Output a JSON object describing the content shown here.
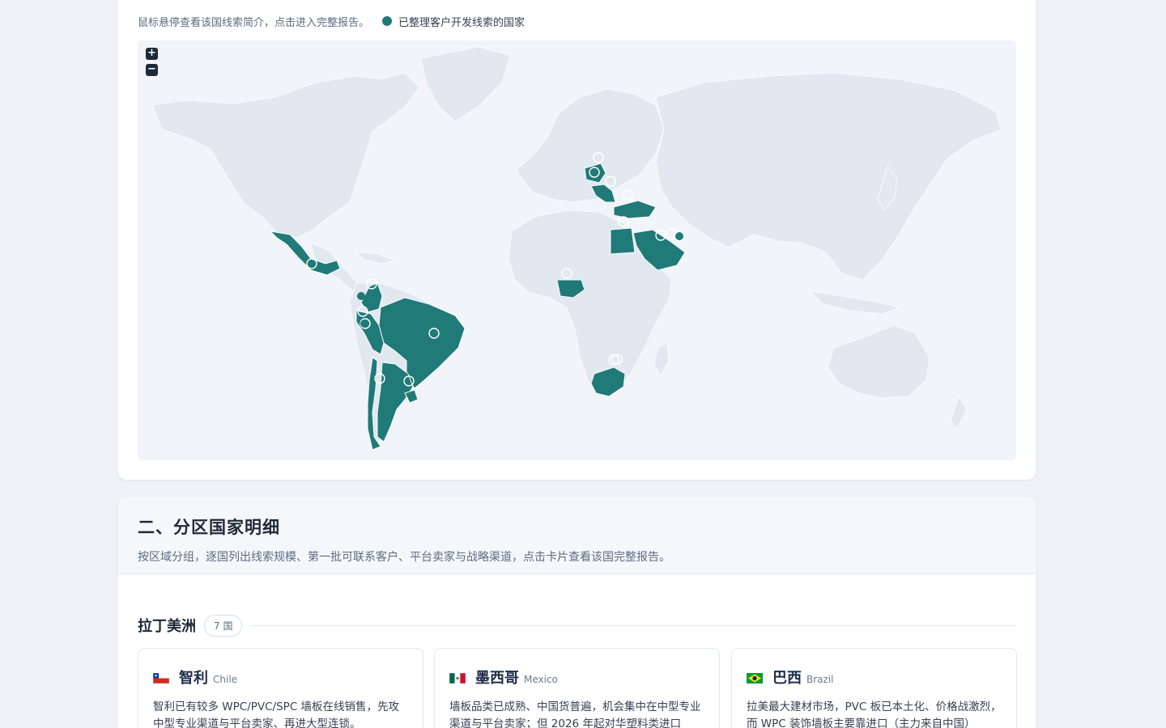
{
  "map_section": {
    "hint": "鼠标悬停查看该国线索简介，点击进入完整报告。",
    "legend_label": "已整理客户开发线索的国家",
    "zoom_in": "+",
    "zoom_out": "−",
    "highlight_color": "#1f7a78",
    "land_color": "#e2e8f0"
  },
  "section": {
    "title": "二、分区国家明细",
    "description": "按区域分组，逐国列出线索规模、第一批可联系客户、平台卖家与战略渠道，点击卡片查看该国完整报告。"
  },
  "region": {
    "name": "拉丁美洲",
    "count": "7 国"
  },
  "countries": [
    {
      "name": "智利",
      "en": "Chile",
      "flag": "chile",
      "summary": "智利已有较多 WPC/PVC/SPC 墙板在线销售，先攻中型专业渠道与平台卖家、再进大型连锁。"
    },
    {
      "name": "墨西哥",
      "en": "Mexico",
      "flag": "mexico",
      "summary": "墙板品类已成熟、中国货普遍，机会集中在中型专业渠道与平台卖家；但 2026 年起对华塑料类进口"
    },
    {
      "name": "巴西",
      "en": "Brazil",
      "flag": "brazil",
      "summary": "拉美最大建材市场，PVC 板已本土化、价格战激烈，而 WPC 装饰墙板主要靠进口（主力来自中国）"
    }
  ]
}
